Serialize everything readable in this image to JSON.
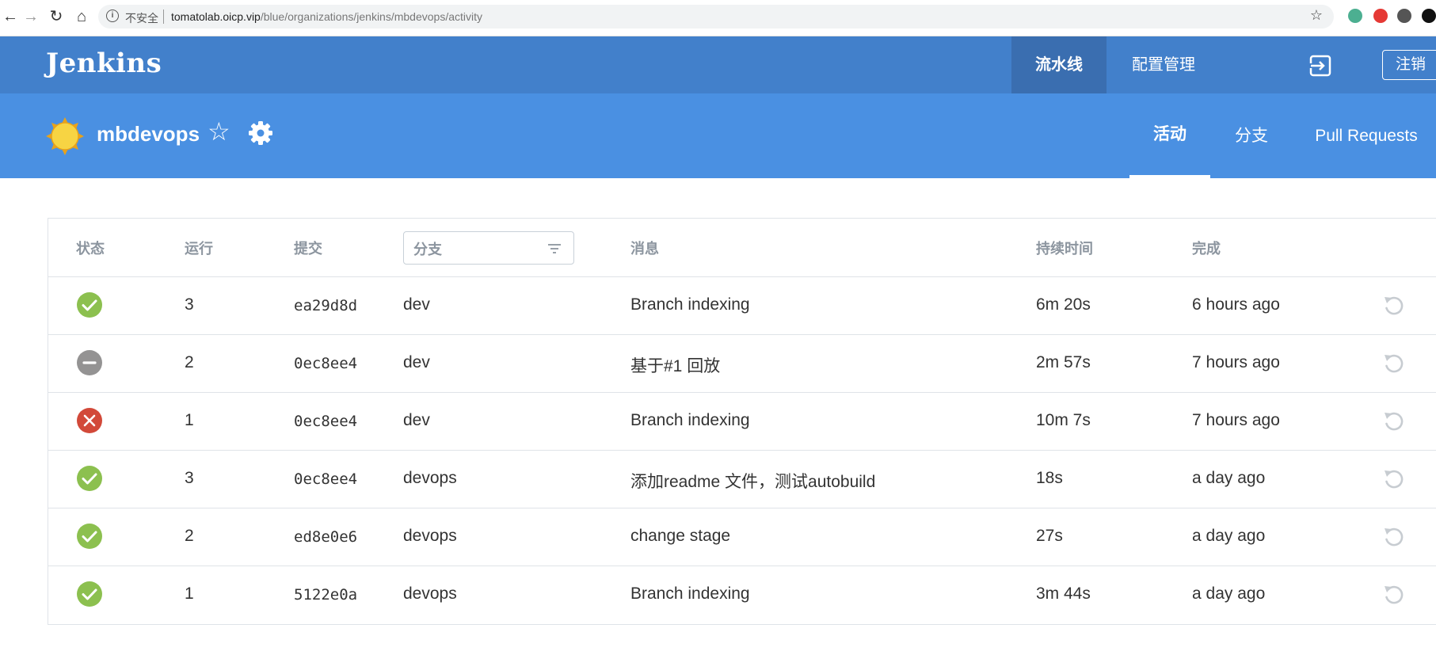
{
  "browser": {
    "insecure_label": "不安全",
    "url_host": "tomatolab.oicp.vip",
    "url_path": "/blue/organizations/jenkins/mbdevops/activity"
  },
  "header": {
    "logo": "Jenkins",
    "nav": [
      {
        "label": "流水线",
        "active": true
      },
      {
        "label": "配置管理",
        "active": false
      }
    ],
    "logout_label": "注销"
  },
  "pipeline": {
    "name": "mbdevops",
    "tabs": [
      {
        "label": "活动",
        "active": true
      },
      {
        "label": "分支",
        "active": false
      },
      {
        "label": "Pull Requests",
        "active": false
      }
    ]
  },
  "table": {
    "headers": {
      "status": "状态",
      "run": "运行",
      "commit": "提交",
      "branch": "分支",
      "message": "消息",
      "duration": "持续时间",
      "completed": "完成"
    },
    "rows": [
      {
        "status": "success",
        "run": "3",
        "commit": "ea29d8d",
        "branch": "dev",
        "message": "Branch indexing",
        "duration": "6m 20s",
        "completed": "6 hours ago"
      },
      {
        "status": "aborted",
        "run": "2",
        "commit": "0ec8ee4",
        "branch": "dev",
        "message": "基于#1 回放",
        "duration": "2m 57s",
        "completed": "7 hours ago"
      },
      {
        "status": "failure",
        "run": "1",
        "commit": "0ec8ee4",
        "branch": "dev",
        "message": "Branch indexing",
        "duration": "10m 7s",
        "completed": "7 hours ago"
      },
      {
        "status": "success",
        "run": "3",
        "commit": "0ec8ee4",
        "branch": "devops",
        "message": "添加readme 文件，测试autobuild",
        "duration": "18s",
        "completed": "a day ago"
      },
      {
        "status": "success",
        "run": "2",
        "commit": "ed8e0e6",
        "branch": "devops",
        "message": "change stage",
        "duration": "27s",
        "completed": "a day ago"
      },
      {
        "status": "success",
        "run": "1",
        "commit": "5122e0a",
        "branch": "devops",
        "message": "Branch indexing",
        "duration": "3m 44s",
        "completed": "a day ago"
      }
    ]
  },
  "colors": {
    "header_bg": "#4280cb",
    "pipeline_bg": "#4a90e2",
    "success": "#8cc04f",
    "failure": "#d24939",
    "aborted": "#949393"
  }
}
